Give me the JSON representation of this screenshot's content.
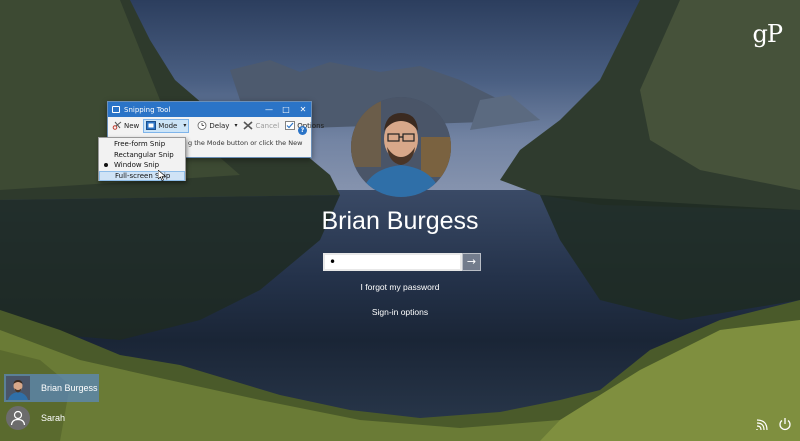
{
  "watermark": {
    "text": "gP"
  },
  "snipping_tool": {
    "title": "Snipping Tool",
    "window_controls": {
      "minimize": "—",
      "maximize": "□",
      "close": "✕"
    },
    "toolbar": {
      "new_label": "New",
      "mode_label": "Mode",
      "delay_label": "Delay",
      "cancel_label": "Cancel",
      "options_label": "Options"
    },
    "message": "g the Mode button or click the New",
    "help_icon": "?",
    "mode_menu": {
      "items": [
        {
          "label": "Free-form Snip",
          "selected": false,
          "hover": false
        },
        {
          "label": "Rectangular Snip",
          "selected": false,
          "hover": false
        },
        {
          "label": "Window Snip",
          "selected": true,
          "hover": false
        },
        {
          "label": "Full-screen Snip",
          "selected": false,
          "hover": true
        }
      ]
    }
  },
  "login": {
    "user_name": "Brian Burgess",
    "password_value": "•",
    "submit_icon": "→",
    "forgot_password": "I forgot my password",
    "sign_in_options": "Sign-in options"
  },
  "user_list": [
    {
      "name": "Brian Burgess",
      "selected": true,
      "avatar": "photo-avatar"
    },
    {
      "name": "Sarah",
      "selected": false,
      "avatar": "generic-person-icon"
    }
  ],
  "system_icons": [
    "network-icon",
    "ease-of-access-icon",
    "power-icon"
  ],
  "colors": {
    "accent": "#2b74c7",
    "selected_user_bg": "#5c88ba",
    "menu_hover": "#cfe3f6"
  }
}
